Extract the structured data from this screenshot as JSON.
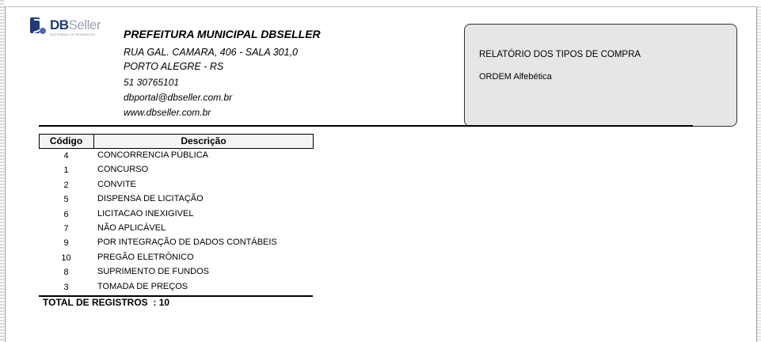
{
  "logo": {
    "brand_bold": "DB",
    "brand_light": "Seller",
    "tagline": "SISTEMAS INTEGRADOS"
  },
  "header": {
    "org_name": "PREFEITURA MUNICIPAL DBSELLER",
    "address_line1": "RUA GAL. CAMARA, 406 - SALA 301,0",
    "address_line2": "PORTO ALEGRE - RS",
    "phone": "51 30765101",
    "email": "dbportal@dbseller.com.br",
    "website": "www.dbseller.com.br"
  },
  "report": {
    "title": "RELATÓRIO DOS TIPOS DE COMPRA",
    "order": "ORDEM Alfebética"
  },
  "table": {
    "columns": [
      "Código",
      "Descrição"
    ],
    "rows": [
      {
        "code": "4",
        "desc": "CONCORRENCIA PÚBLICA"
      },
      {
        "code": "1",
        "desc": "CONCURSO"
      },
      {
        "code": "2",
        "desc": "CONVITE"
      },
      {
        "code": "5",
        "desc": "DISPENSA DE LICITAÇÃO"
      },
      {
        "code": "6",
        "desc": "LICITACAO INEXIGIVEL"
      },
      {
        "code": "7",
        "desc": "NÃO APLICÁVEL"
      },
      {
        "code": "9",
        "desc": "POR INTEGRAÇÃO DE DADOS CONTÁBEIS"
      },
      {
        "code": "10",
        "desc": "PREGÃO ELETRÔNICO"
      },
      {
        "code": "8",
        "desc": "SUPRIMENTO DE FUNDOS"
      },
      {
        "code": "3",
        "desc": "TOMADA DE PREÇOS"
      }
    ]
  },
  "total": {
    "label": "TOTAL DE REGISTROS  :",
    "value": "10"
  }
}
